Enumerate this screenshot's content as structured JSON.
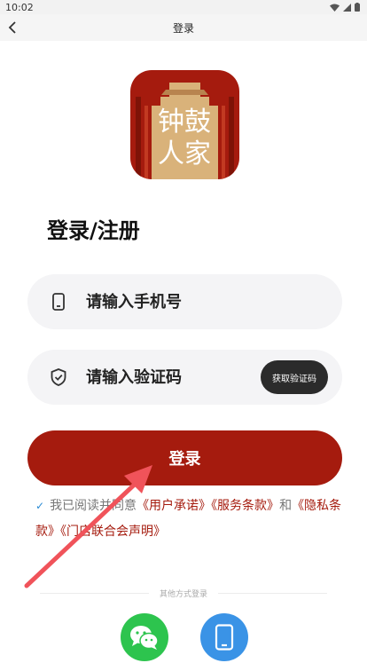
{
  "status": {
    "time": "10:02"
  },
  "nav": {
    "title": "登录"
  },
  "logo": {
    "line1": "钟鼓",
    "line2": "人家",
    "colors": {
      "red": "#a51b0e",
      "gold": "#d9b27a"
    }
  },
  "page_title": "登录/注册",
  "phone_field": {
    "placeholder": "请输入手机号",
    "icon": "phone-icon"
  },
  "code_field": {
    "placeholder": "请输入验证码",
    "icon": "shield-check-icon",
    "button_label": "获取验证码"
  },
  "login_button": {
    "label": "登录"
  },
  "agreement": {
    "prefix": "我已阅读并同意",
    "link_user": "《用户承诺》",
    "link_service": "《服务条款》",
    "conjunction": "和",
    "link_privacy": "《隐私条款》",
    "link_store": "《门店联合会声明》"
  },
  "other_login": {
    "label": "其他方式登录",
    "wechat_icon": "wechat-icon",
    "mobile_icon": "mobile-icon"
  },
  "colors": {
    "brand": "#a51b0e",
    "wechat": "#2dc44e",
    "mobile": "#3a93e6"
  }
}
